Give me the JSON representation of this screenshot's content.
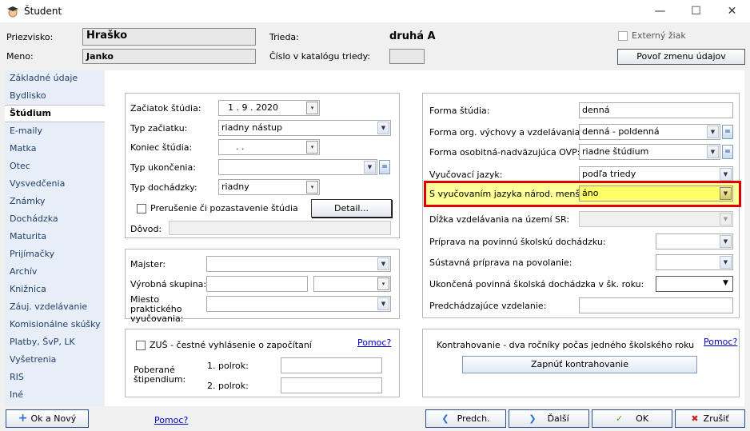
{
  "window": {
    "title": "Študent"
  },
  "header": {
    "surname_label": "Priezvisko:",
    "surname": "Hraško",
    "name_label": "Meno:",
    "name": "Janko",
    "class_label": "Trieda:",
    "class_value": "druhá A",
    "catalog_label": "Číslo v katalógu triedy:",
    "catalog_value": "",
    "external_label": "Externý žiak",
    "allow_button": "Povoľ zmenu údajov"
  },
  "sidebar": {
    "items": [
      "Základné údaje",
      "Bydlisko",
      "Štúdium",
      "E-maily",
      "Matka",
      "Otec",
      "Vysvedčenia",
      "Známky",
      "Dochádzka",
      "Maturita",
      "Prijímačky",
      "Archív",
      "Knižnica",
      "Záuj. vzdelávanie",
      "Komisionálne skúšky",
      "Platby, ŠvP, LK",
      "Vyšetrenia",
      "RIS",
      "Iné"
    ],
    "active": "Štúdium"
  },
  "study": {
    "start_label": "Začiatok štúdia:",
    "start_value": "1 .  9 . 2020",
    "start_type_label": "Typ začiatku:",
    "start_type_value": "riadny nástup",
    "end_label": "Koniec štúdia:",
    "end_value": ".    .",
    "end_type_label": "Typ ukončenia:",
    "end_type_value": "",
    "attendance_label": "Typ dochádzky:",
    "attendance_value": "riadny",
    "interrupt_label": "Prerušenie či pozastavenie štúdia",
    "detail_button": "Detail...",
    "reason_label": "Dôvod:",
    "reason_value": ""
  },
  "master": {
    "master_label": "Majster:",
    "master_value": "",
    "group_label": "Výrobná skupina:",
    "group_value": "",
    "group_select": "",
    "place_label": "Miesto praktického vyučovania:",
    "place_value": ""
  },
  "zus": {
    "check_label": "ZUŠ - čestné vyhlásenie o započítaní",
    "help": "Pomoc?",
    "scholarship_label": "Poberané štipendium:",
    "h1_label": "1. polrok:",
    "h1_value": "",
    "h2_label": "2. polrok:",
    "h2_value": ""
  },
  "form": {
    "study_form_label": "Forma štúdia:",
    "study_form_value": "denná",
    "org_form_label": "Forma org. výchovy a vzdelávania:",
    "org_form_value": "denná - poldenná",
    "special_label": "Forma osobitná-nadväzujúca OVP:",
    "special_value": "riadne štúdium",
    "lang_label": "Vyučovací jazyk:",
    "lang_value": "podľa triedy",
    "minority_label": "S vyučovaním jazyka národ. menšiny:",
    "minority_value": "áno",
    "length_label": "Dĺžka vzdelávania na území SR:",
    "length_value": "",
    "prep_label": "Príprava na povinnú školskú dochádzku:",
    "prep_value": "",
    "cont_label": "Sústavná príprava na povolanie:",
    "cont_value": "",
    "finished_label": "Ukončená povinná školská dochádzka v šk. roku:",
    "finished_value": "",
    "previous_label": "Predchádzajúce vzdelanie:",
    "previous_value": ""
  },
  "contra": {
    "text": "Kontrahovanie - dva ročníky počas jedného školského roku",
    "help": "Pomoc?",
    "button": "Zapnúť kontrahovanie"
  },
  "footer": {
    "ok_new": "Ok a Nový",
    "help": "Pomoc?",
    "prev": "Predch.",
    "next": "Ďalší",
    "ok": "OK",
    "cancel": "Zrušiť"
  },
  "colors": {
    "highlight_bg": "#ffff99",
    "highlight_border": "#e00000",
    "selected_combo": "#ffff66"
  }
}
